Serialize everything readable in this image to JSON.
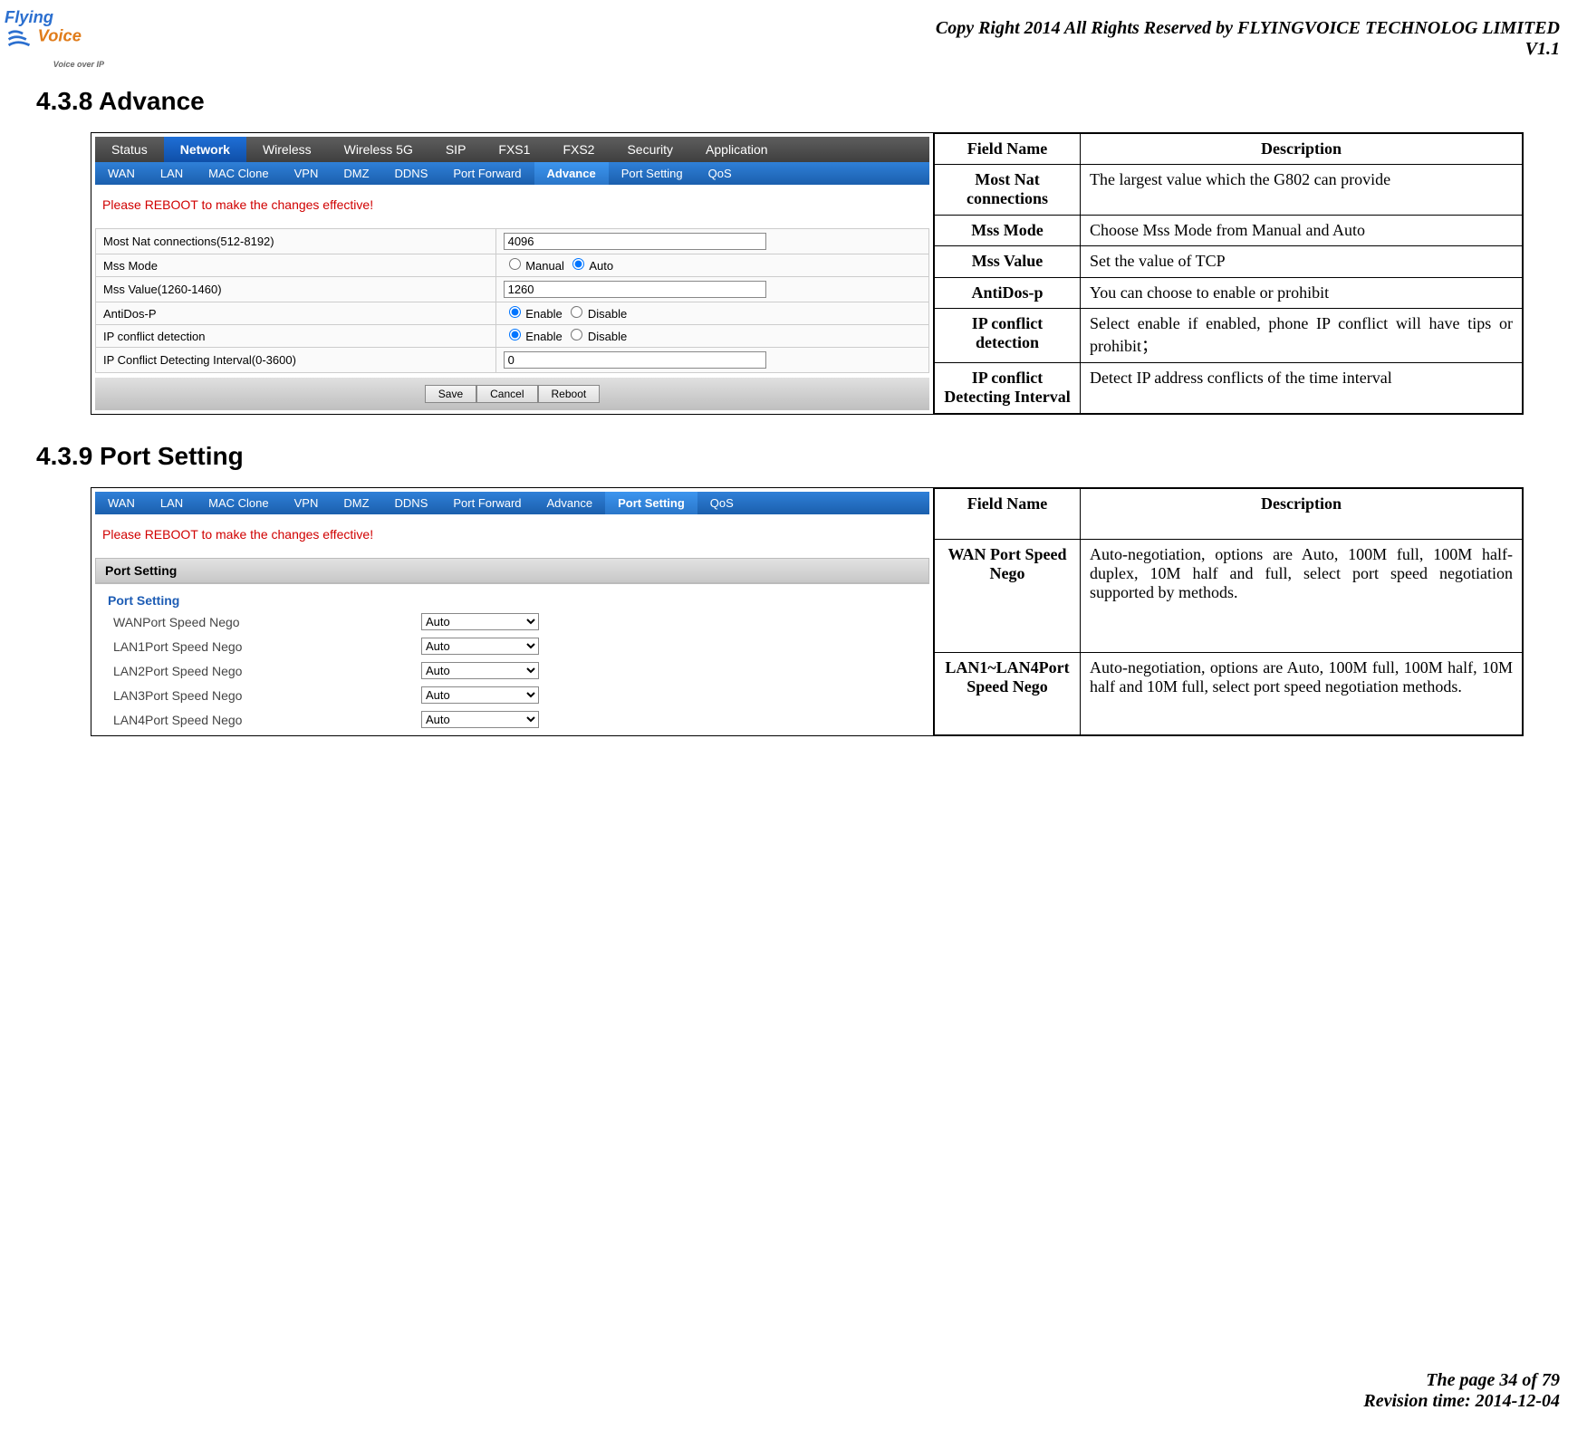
{
  "header": {
    "copy": "Copy Right 2014 All Rights Reserved by FLYINGVOICE TECHNOLOG LIMITED",
    "version": "V1.1"
  },
  "logo_tag": "Voice over IP",
  "section_a": {
    "title": "4.3.8 Advance",
    "tabs1": [
      "Status",
      "Network",
      "Wireless",
      "Wireless 5G",
      "SIP",
      "FXS1",
      "FXS2",
      "Security",
      "Application"
    ],
    "tabs1_active": "Network",
    "tabs2": [
      "WAN",
      "LAN",
      "MAC Clone",
      "VPN",
      "DMZ",
      "DDNS",
      "Port Forward",
      "Advance",
      "Port Setting",
      "QoS"
    ],
    "tabs2_active": "Advance",
    "reboot": "Please REBOOT to make the changes effective!",
    "rows": [
      {
        "label": "Most Nat connections(512-8192)",
        "value": "4096",
        "type": "text"
      },
      {
        "label": "Mss Mode",
        "type": "radio",
        "opts": [
          "Manual",
          "Auto"
        ],
        "sel": "Auto"
      },
      {
        "label": "Mss Value(1260-1460)",
        "value": "1260",
        "type": "text"
      },
      {
        "label": "AntiDos-P",
        "type": "radio",
        "opts": [
          "Enable",
          "Disable"
        ],
        "sel": "Enable"
      },
      {
        "label": "IP conflict detection",
        "type": "radio",
        "opts": [
          "Enable",
          "Disable"
        ],
        "sel": "Enable"
      },
      {
        "label": "IP Conflict Detecting Interval(0-3600)",
        "value": "0",
        "type": "text"
      }
    ],
    "buttons": [
      "Save",
      "Cancel",
      "Reboot"
    ],
    "desc_thead": [
      "Field Name",
      "Description"
    ],
    "desc": [
      {
        "f": "Most Nat connections",
        "d": "The largest value which the G802 can provide"
      },
      {
        "f": "Mss Mode",
        "d": "Choose Mss Mode from Manual and Auto"
      },
      {
        "f": "Mss Value",
        "d": "Set the value of TCP"
      },
      {
        "f": "AntiDos-p",
        "d": "You can choose to enable or prohibit"
      },
      {
        "f": "IP conflict detection",
        "d": "Select enable if enabled, phone IP conflict will have tips or prohibit；"
      },
      {
        "f": "IP conflict Detecting Interval",
        "d": "Detect IP address conflicts of the time interval"
      }
    ]
  },
  "section_b": {
    "title": "4.3.9 Port Setting",
    "tabs2": [
      "WAN",
      "LAN",
      "MAC Clone",
      "VPN",
      "DMZ",
      "DDNS",
      "Port Forward",
      "Advance",
      "Port Setting",
      "QoS"
    ],
    "tabs2_active": "Port Setting",
    "reboot": "Please REBOOT to make the changes effective!",
    "panel_head": "Port Setting",
    "panel_sub": "Port Setting",
    "rows": [
      {
        "label": "WANPort Speed Nego",
        "value": "Auto"
      },
      {
        "label": "LAN1Port Speed Nego",
        "value": "Auto"
      },
      {
        "label": "LAN2Port Speed Nego",
        "value": "Auto"
      },
      {
        "label": "LAN3Port Speed Nego",
        "value": "Auto"
      },
      {
        "label": "LAN4Port Speed Nego",
        "value": "Auto"
      }
    ],
    "desc_thead": [
      "Field Name",
      "Description"
    ],
    "desc": [
      {
        "f": "WAN Port Speed Nego",
        "d": "Auto-negotiation, options are Auto, 100M full, 100M half-duplex, 10M half and full, select port speed negotiation supported by methods."
      },
      {
        "f": "LAN1~LAN4Port Speed Nego",
        "d": "Auto-negotiation, options are Auto, 100M full, 100M half, 10M half and 10M full, select port speed negotiation methods."
      }
    ]
  },
  "footer": {
    "page": "The page 34 of 79",
    "rev": "Revision time: 2014-12-04"
  }
}
